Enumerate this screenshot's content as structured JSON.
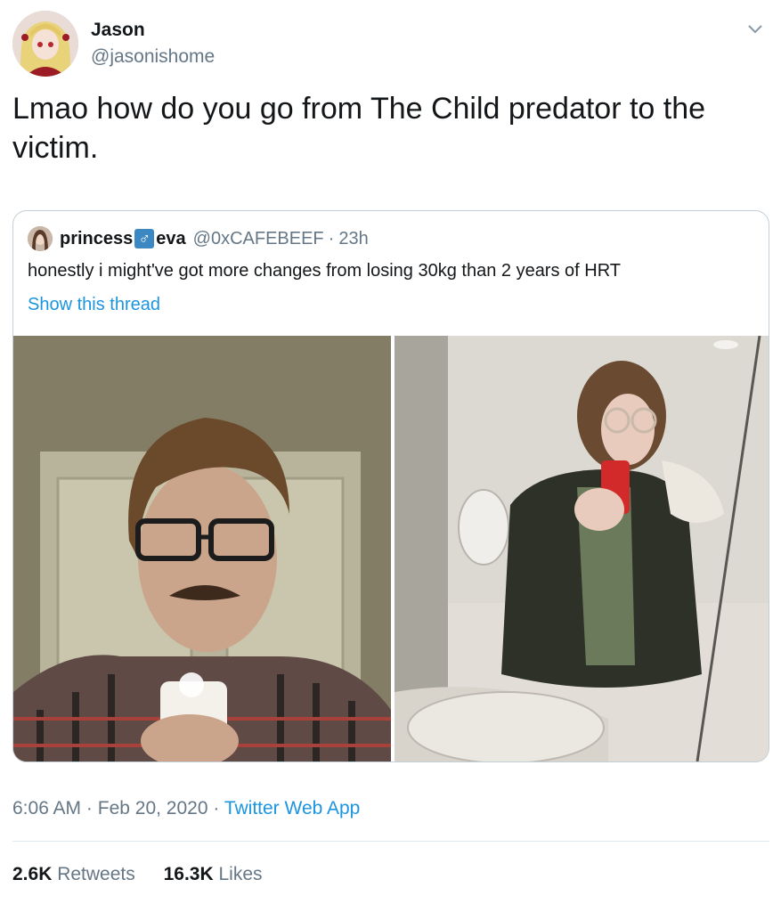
{
  "author": {
    "name": "Jason",
    "handle": "@jasonishome",
    "avatar_icon": "anime-avatar"
  },
  "tweet": {
    "text": "Lmao how do you go from The Child predator to the victim."
  },
  "quoted_tweet": {
    "name_part1": "princess",
    "symbol": "♂",
    "name_part2": "eva",
    "handle": "@0xCAFEBEEF",
    "separator": "·",
    "time": "23h",
    "text": "honestly i might've got more changes from losing 30kg than 2 years of HRT",
    "show_thread": "Show this thread",
    "photos": [
      "before-photo",
      "after-photo"
    ]
  },
  "meta": {
    "time": "6:06 AM",
    "sep1": "·",
    "date": "Feb 20, 2020",
    "sep2": "·",
    "app": "Twitter Web App"
  },
  "stats": {
    "retweets_count": "2.6K",
    "retweets_label": "Retweets",
    "likes_count": "16.3K",
    "likes_label": "Likes"
  },
  "colors": {
    "link": "#1b95e0",
    "secondary_text": "#657786",
    "border": "#c4cfd6"
  }
}
